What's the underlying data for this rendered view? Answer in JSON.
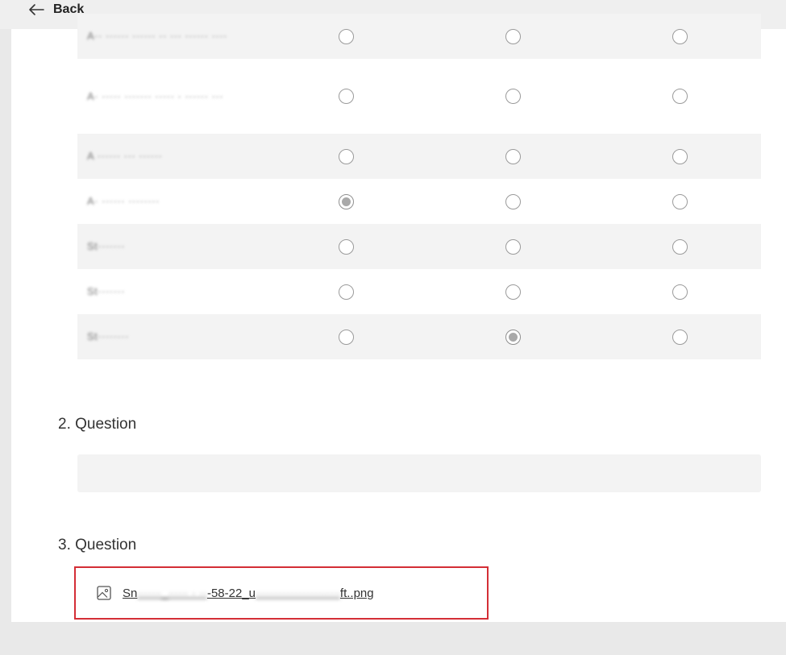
{
  "header": {
    "back_label": "Back"
  },
  "matrix": {
    "rows": [
      {
        "label": "A·· ······ ······ ·· ··· ······ ····",
        "selected": null,
        "shaded": true
      },
      {
        "label": "A· ····· ······· ····· · ······ ···",
        "selected": null,
        "shaded": false
      },
      {
        "label": "A ······ ··· ······",
        "selected": null,
        "shaded": true
      },
      {
        "label": "A· ······ ········",
        "selected": 0,
        "shaded": false
      },
      {
        "label": "St·······",
        "selected": null,
        "shaded": true
      },
      {
        "label": "St·······",
        "selected": null,
        "shaded": false
      },
      {
        "label": "St········",
        "selected": 1,
        "shaded": true
      }
    ]
  },
  "questions": {
    "q2": {
      "title": "2. Question"
    },
    "q3": {
      "title": "3. Question",
      "file_prefix": "Sn",
      "file_blur_1": "······_····· · ··",
      "file_mid": "-58-22_u",
      "file_blur_2": "·····················",
      "file_suffix": "ft..png"
    }
  },
  "colors": {
    "highlight_border": "#d42e36",
    "row_shade": "#f3f3f3"
  }
}
